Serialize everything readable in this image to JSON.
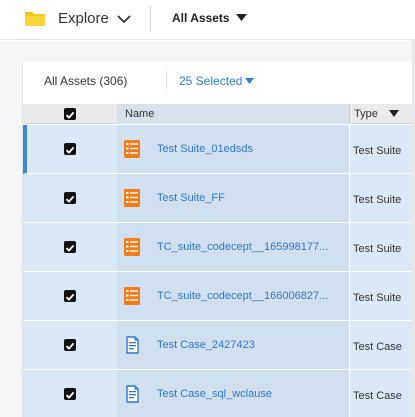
{
  "topbar": {
    "explore_label": "Explore",
    "scope_label": "All Assets"
  },
  "list": {
    "count_label": "All Assets (306)",
    "selected_label": "25 Selected"
  },
  "columns": {
    "name": "Name",
    "type": "Type"
  },
  "rows": [
    {
      "name": "Test Suite_01edsds",
      "type": "Test Suite",
      "icon": "test-suite-icon",
      "checked": true
    },
    {
      "name": "Test Suite_FF",
      "type": "Test Suite",
      "icon": "test-suite-icon",
      "checked": true
    },
    {
      "name": "TC_suite_codecept__165998177...",
      "type": "Test Suite",
      "icon": "test-suite-icon",
      "checked": true
    },
    {
      "name": "TC_suite_codecept__166006827...",
      "type": "Test Suite",
      "icon": "test-suite-icon",
      "checked": true
    },
    {
      "name": "Test Case_2427423",
      "type": "Test Case",
      "icon": "test-case-icon",
      "checked": true
    },
    {
      "name": "Test Case_sql_wclause",
      "type": "Test Case",
      "icon": "test-case-icon",
      "checked": true
    }
  ],
  "colors": {
    "accent": "#3a87d6",
    "link": "#2f78c4",
    "suite_icon": "#f07d18",
    "selected_row": "#dbe9f7",
    "folder": "#f5c518"
  }
}
